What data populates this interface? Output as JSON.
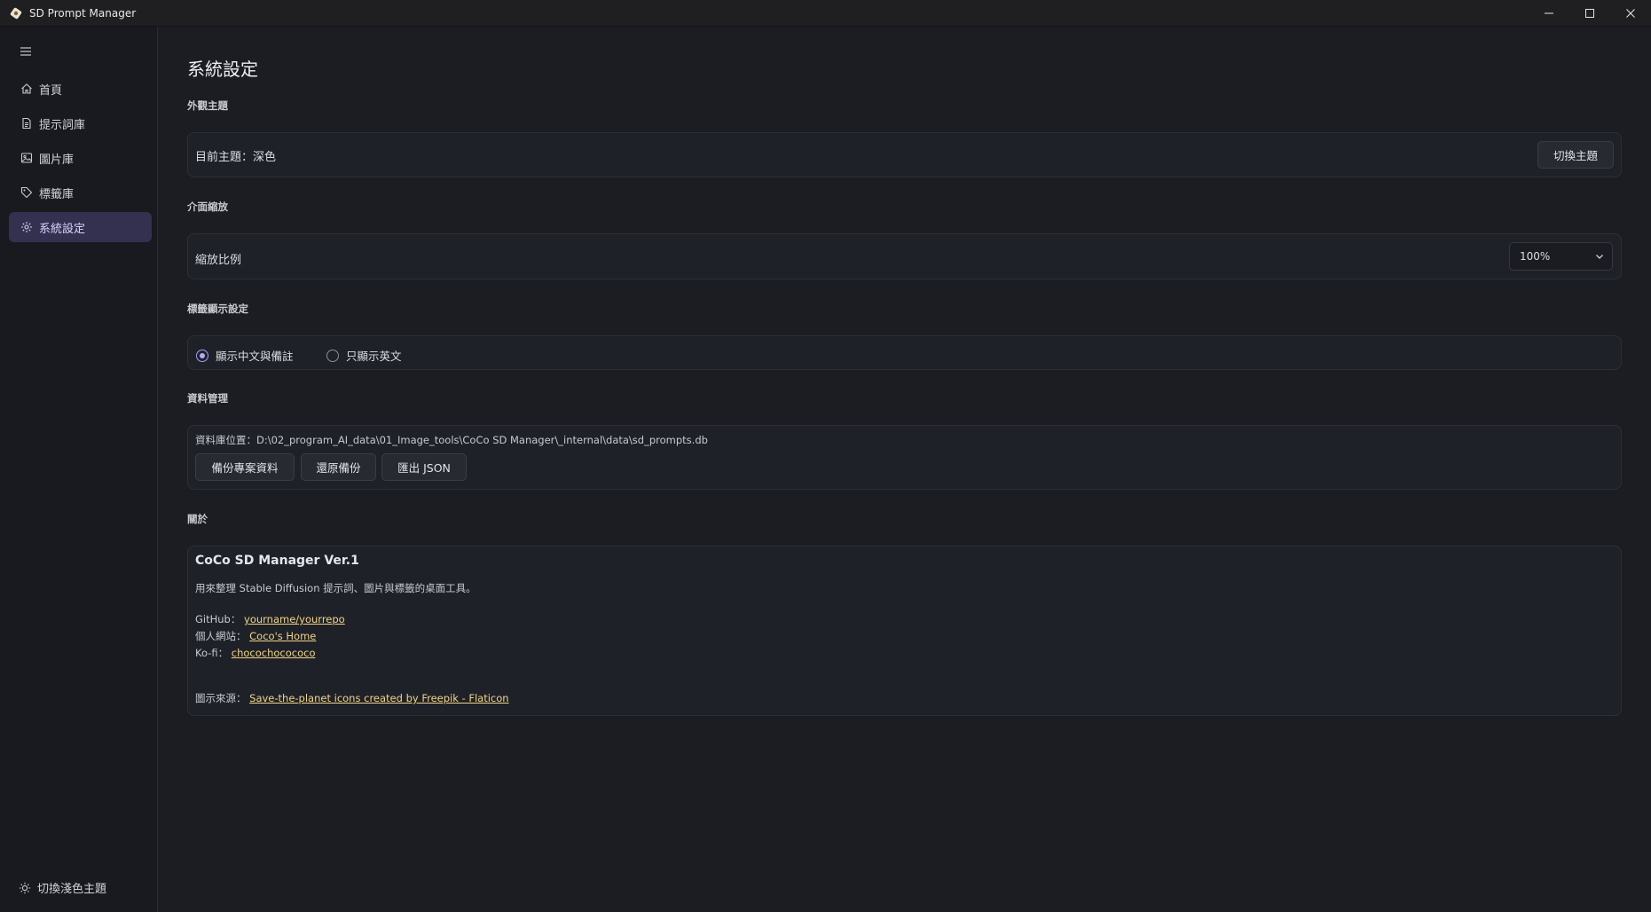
{
  "window": {
    "title": "SD Prompt Manager"
  },
  "sidebar": {
    "items": [
      {
        "label": "首頁",
        "icon": "home-icon"
      },
      {
        "label": "提示詞庫",
        "icon": "document-icon"
      },
      {
        "label": "圖片庫",
        "icon": "image-icon"
      },
      {
        "label": "標籤庫",
        "icon": "tag-icon"
      },
      {
        "label": "系統設定",
        "icon": "gear-icon",
        "active": true
      }
    ],
    "footer_label": "切換淺色主題"
  },
  "page": {
    "title": "系統設定"
  },
  "appearance": {
    "section_label": "外觀主題",
    "current_theme": "目前主題：深色",
    "toggle_button": "切換主題"
  },
  "zoom": {
    "section_label": "介面縮放",
    "label": "縮放比例",
    "selected": "100%"
  },
  "tag_display": {
    "section_label": "標籤顯示設定",
    "option_1": "顯示中文與備註",
    "option_2": "只顯示英文",
    "selected_index": 0
  },
  "data_mgmt": {
    "section_label": "資料管理",
    "db_path": "資料庫位置：D:\\02_program_AI_data\\01_Image_tools\\CoCo SD Manager\\_internal\\data\\sd_prompts.db",
    "backup_button": "備份專案資料",
    "restore_button": "還原備份",
    "export_button": "匯出 JSON"
  },
  "about": {
    "section_label": "關於",
    "title": "CoCo SD Manager Ver.1",
    "description": "用來整理 Stable Diffusion 提示詞、圖片與標籤的桌面工具。",
    "github_label": "GitHub：",
    "github_link": "yourname/yourrepo",
    "website_label": "個人網站：",
    "website_link": "Coco's Home",
    "kofi_label": "Ko-fi：",
    "kofi_link": "chocochocococo",
    "icon_source_label": "圖示來源：",
    "icon_source_link": "Save-the-planet icons created by Freepik - Flaticon"
  },
  "colors": {
    "accent": "#b6aaff",
    "active_nav_bg": "#34304f",
    "link": "#f0d487"
  }
}
